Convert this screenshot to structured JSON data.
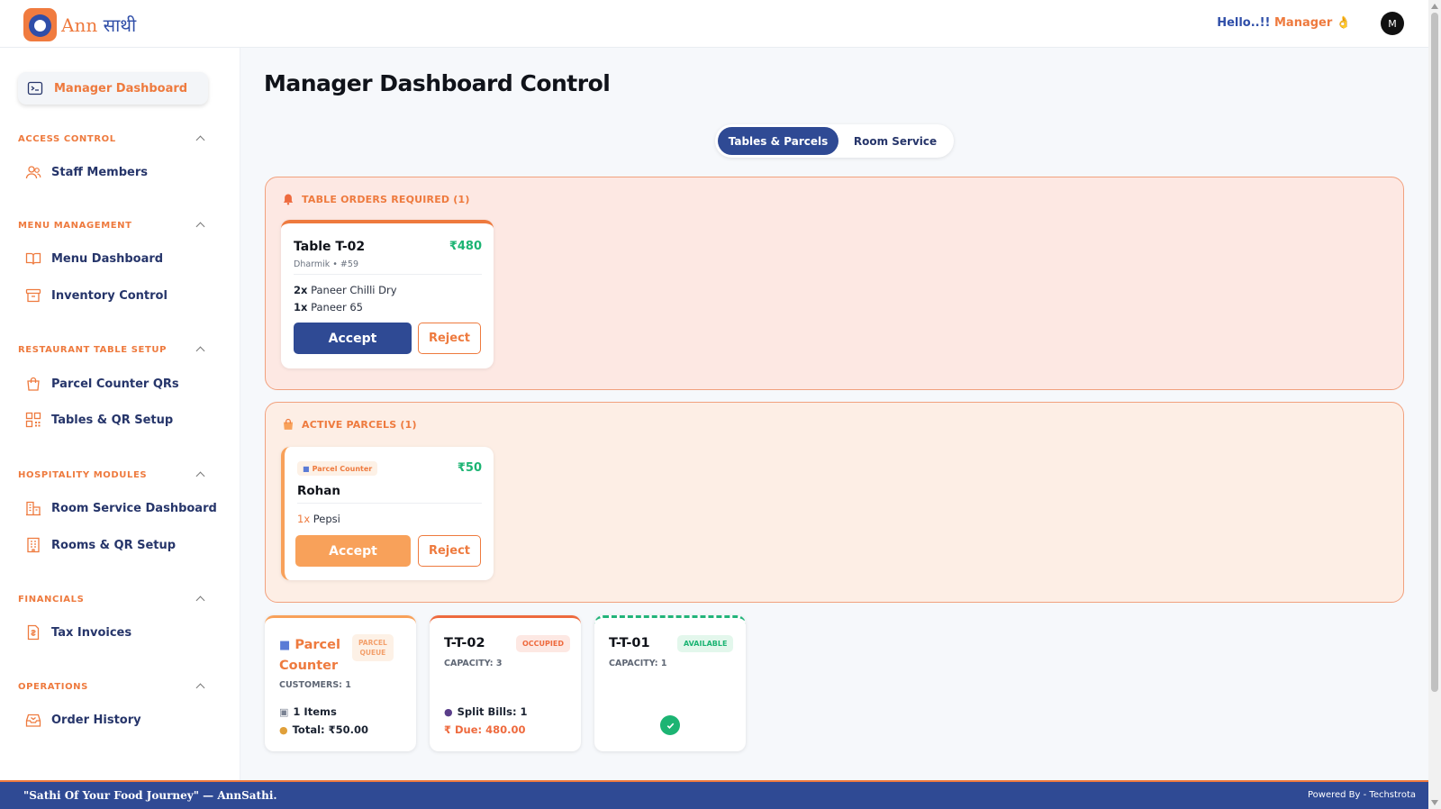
{
  "header": {
    "logo_ann": "Ann",
    "logo_sathi": "साथी",
    "greeting_prefix": "Hello..!!",
    "greeting_name": "Manager",
    "greeting_emoji": "👌",
    "avatar_initial": "M"
  },
  "sidebar": {
    "active_item": "Manager Dashboard",
    "sections": [
      {
        "title": "ACCESS CONTROL",
        "items": [
          "Staff Members"
        ]
      },
      {
        "title": "MENU MANAGEMENT",
        "items": [
          "Menu Dashboard",
          "Inventory Control"
        ]
      },
      {
        "title": "RESTAURANT TABLE SETUP",
        "items": [
          "Parcel Counter QRs",
          "Tables & QR Setup"
        ]
      },
      {
        "title": "HOSPITALITY MODULES",
        "items": [
          "Room Service Dashboard",
          "Rooms & QR Setup"
        ]
      },
      {
        "title": "FINANCIALS",
        "items": [
          "Tax Invoices"
        ]
      },
      {
        "title": "OPERATIONS",
        "items": [
          "Order History"
        ]
      }
    ]
  },
  "main": {
    "title": "Manager Dashboard Control",
    "tabs": [
      "Tables & Parcels",
      "Room Service"
    ],
    "orders_panel": {
      "heading": "TABLE ORDERS REQUIRED (1)",
      "card": {
        "table": "Table T-02",
        "price": "₹480",
        "meta": "Dharmik • #59",
        "items": [
          {
            "qty": "2x",
            "name": "Paneer Chilli Dry"
          },
          {
            "qty": "1x",
            "name": "Paneer 65"
          }
        ],
        "accept": "Accept",
        "reject": "Reject"
      }
    },
    "parcels_panel": {
      "heading": "ACTIVE PARCELS (1)",
      "card": {
        "badge": "Parcel Counter",
        "price": "₹50",
        "customer": "Rohan",
        "items": [
          {
            "qty": "1x",
            "name": "Pepsi"
          }
        ],
        "accept": "Accept",
        "reject": "Reject"
      }
    },
    "table_cards": [
      {
        "title_line1": "Parcel",
        "title_line2": "Counter",
        "badge_line1": "PARCEL",
        "badge_line2": "QUEUE",
        "meta": "CUSTOMERS: 1",
        "items": "1 Items",
        "total": "Total: ₹50.00"
      },
      {
        "title": "T-T-02",
        "badge": "OCCUPIED",
        "meta": "CAPACITY: 3",
        "split": "Split Bills: 1",
        "due": "₹ Due: 480.00"
      },
      {
        "title": "T-T-01",
        "badge": "AVAILABLE",
        "meta": "CAPACITY: 1"
      }
    ]
  },
  "footer": {
    "tagline": "\"Sathi Of Your Food Journey\" — AnnSathi.",
    "powered": "Powered By - Techstrota"
  },
  "colors": {
    "accent_orange": "#ee7a3e",
    "brand_blue": "#2f4a94",
    "success_green": "#1cb473",
    "orders_bg": "#fde8e3",
    "parcels_bg": "#fdeee5"
  }
}
